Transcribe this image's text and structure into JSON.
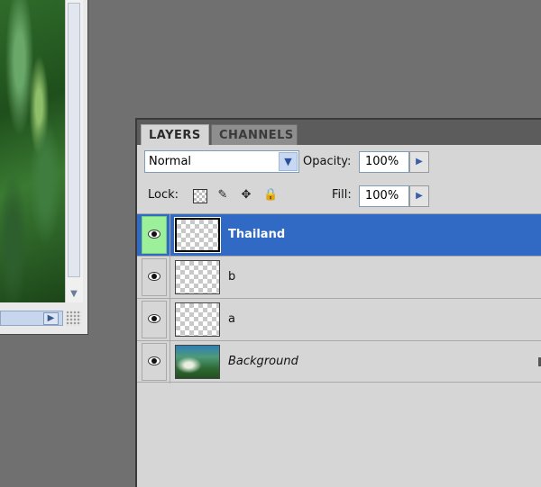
{
  "panel": {
    "tabs": [
      {
        "label": "LAYERS",
        "active": true
      },
      {
        "label": "CHANNELS",
        "active": false
      }
    ],
    "blend_mode": "Normal",
    "opacity_label": "Opacity:",
    "opacity_value": "100%",
    "lock_label": "Lock:",
    "lock_icons": [
      "lock-transparent-icon",
      "lock-brush-icon",
      "lock-move-icon",
      "lock-all-icon"
    ],
    "fill_label": "Fill:",
    "fill_value": "100%"
  },
  "layers": [
    {
      "name": "Thailand",
      "visible": true,
      "selected": true,
      "thumbnail": "transparent"
    },
    {
      "name": "b",
      "visible": true,
      "selected": false,
      "thumbnail": "transparent"
    },
    {
      "name": "a",
      "visible": true,
      "selected": false,
      "thumbnail": "transparent"
    },
    {
      "name": "Background",
      "visible": true,
      "selected": false,
      "thumbnail": "photo",
      "locked": true
    }
  ],
  "colors": {
    "selection": "#316ac5",
    "eye_highlight": "#9cf09a",
    "workspace": "#707070"
  }
}
